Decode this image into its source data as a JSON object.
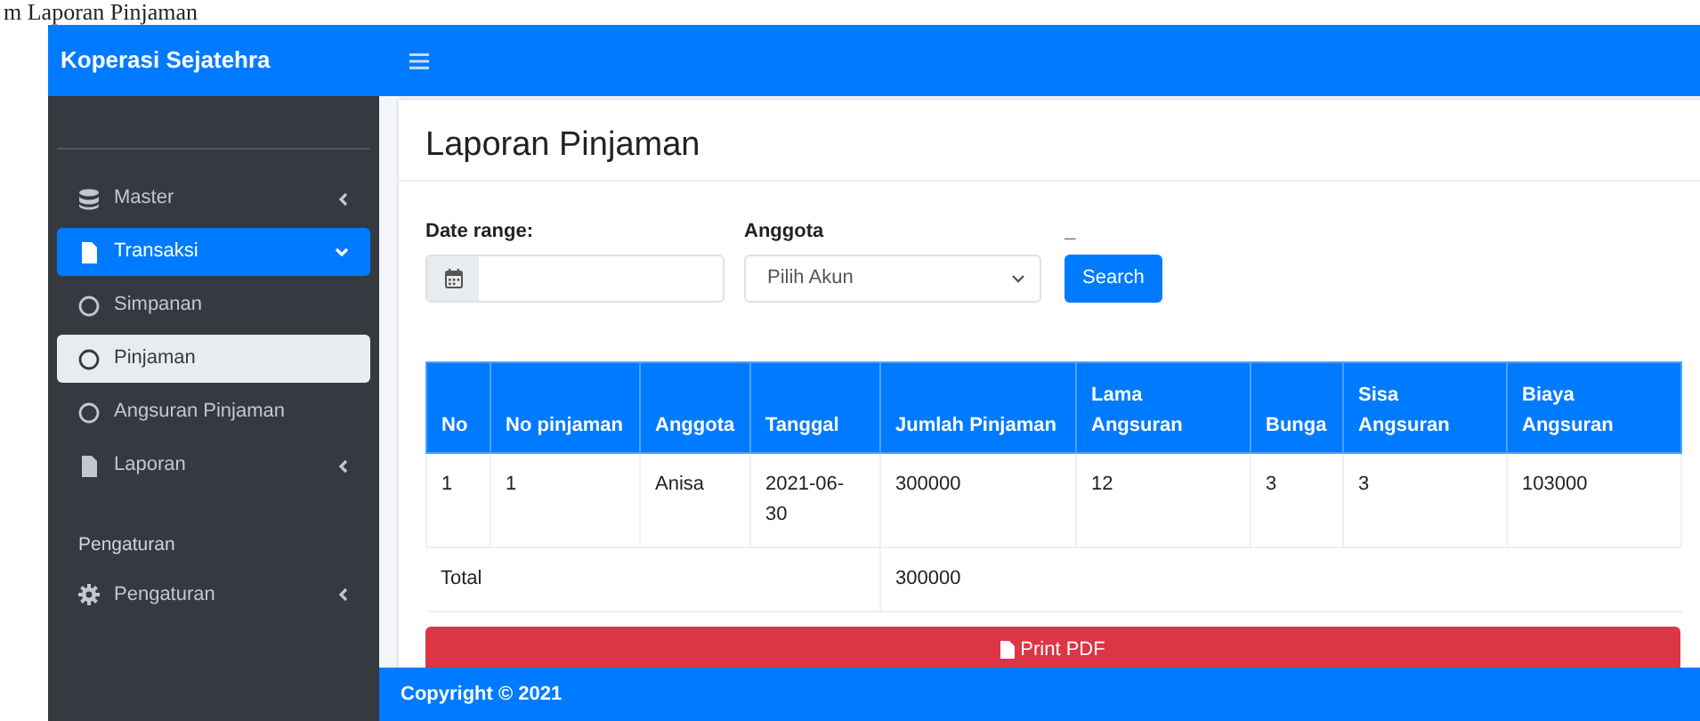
{
  "caption": "m Laporan Pinjaman",
  "brand": "Koperasi Sejatehra",
  "sidebar": {
    "items": [
      {
        "kind": "group",
        "label": "Master",
        "selected": false,
        "expanded": false
      },
      {
        "kind": "group",
        "label": "Transaksi",
        "selected": true,
        "expanded": true,
        "children": [
          {
            "kind": "link",
            "label": "Simpanan",
            "selected": false
          },
          {
            "kind": "link",
            "label": "Pinjaman",
            "selected": true
          },
          {
            "kind": "link",
            "label": "Angsuran Pinjaman",
            "selected": false
          }
        ]
      },
      {
        "kind": "group",
        "label": "Laporan",
        "selected": false,
        "expanded": false
      },
      {
        "kind": "header",
        "label": "Pengaturan"
      },
      {
        "kind": "group",
        "label": "Pengaturan",
        "selected": false,
        "expanded": false
      }
    ]
  },
  "page_title": "Laporan Pinjaman",
  "filters": {
    "date_label": "Date range:",
    "member_label": "Anggota",
    "member_select": "Pilih Akun",
    "search_label": "_",
    "search_button": "Search"
  },
  "table": {
    "columns": [
      "No",
      "No pinjaman",
      "Anggota",
      "Tanggal",
      "Jumlah Pinjaman",
      "Lama Angsuran",
      "Bunga",
      "Sisa Angsuran",
      "Biaya Angsuran"
    ],
    "rows": [
      [
        "1",
        "1",
        "Anisa",
        "2021-06-30",
        "300000",
        "12",
        "3",
        "3",
        "103000"
      ]
    ],
    "total": {
      "label": "Total",
      "value": "300000"
    }
  },
  "print_button": "Print PDF",
  "footer": "Copyright © 2021"
}
